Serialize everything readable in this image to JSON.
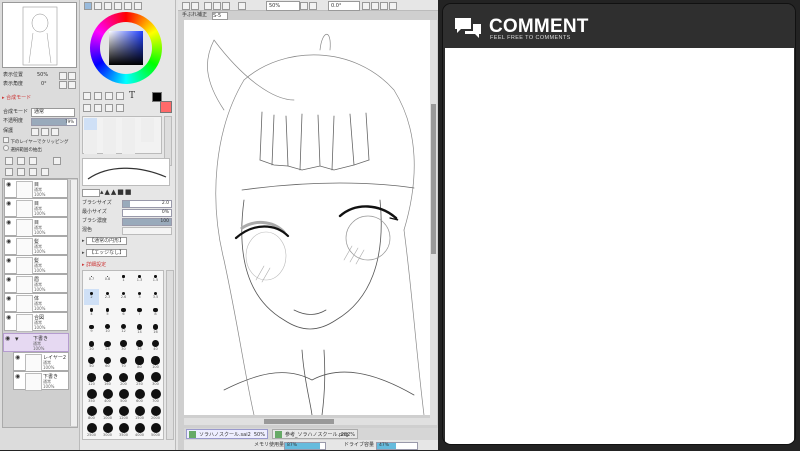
{
  "navigator": {
    "zoom_label": "表示位置",
    "zoom_value": "50%",
    "angle_label": "表示角度",
    "angle_value": "0°"
  },
  "layer_props": {
    "mode_label": "合成モード",
    "mode_value": "通常",
    "opacity_label": "不透明度",
    "opacity_value": "79%",
    "protect_label": "保護",
    "clip_label": "下のレイヤーでクリッピング",
    "select_label": "選択範囲の抽出"
  },
  "layers": [
    {
      "name": "目",
      "mode": "通常",
      "opacity": "100%"
    },
    {
      "name": "目",
      "mode": "通常",
      "opacity": "100%"
    },
    {
      "name": "目",
      "mode": "通常",
      "opacity": "100%"
    },
    {
      "name": "髪",
      "mode": "通常",
      "opacity": "100%"
    },
    {
      "name": "髪",
      "mode": "通常",
      "opacity": "100%"
    },
    {
      "name": "眉",
      "mode": "通常",
      "opacity": "100%"
    },
    {
      "name": "体",
      "mode": "通常",
      "opacity": "100%"
    },
    {
      "name": "合図",
      "mode": "通常",
      "opacity": "100%"
    }
  ],
  "folder": {
    "name": "下書き",
    "mode": "通常",
    "opacity": "100%"
  },
  "sublayers": [
    {
      "name": "レイヤー2",
      "mode": "通常",
      "opacity": "100%"
    },
    {
      "name": "下書き",
      "mode": "通常",
      "opacity": "100%"
    }
  ],
  "tool": {
    "size_label": "ブラシサイズ",
    "size_value": "2.0",
    "min_label": "最小サイズ",
    "min_value": "0%",
    "density_label": "ブラシ濃度",
    "density_value": "100",
    "blend_label": "混色",
    "mode_a": "【通常の円形】",
    "mode_b": "【エッジなし】",
    "extra_label": "詳細設定"
  },
  "brush_sizes": [
    "0.7",
    "0.8",
    "1",
    "1.3",
    "1.5",
    "2",
    "2.3",
    "2.6",
    "3",
    "3.5",
    "4",
    "5",
    "6",
    "7",
    "8",
    "9",
    "10",
    "12",
    "14",
    "16",
    "20",
    "25",
    "30",
    "35",
    "40",
    "50",
    "60",
    "70",
    "80",
    "100",
    "120",
    "160",
    "200",
    "250",
    "300",
    "350",
    "400",
    "500",
    "600",
    "700",
    "800",
    "1000",
    "1200",
    "1500",
    "2000",
    "2500",
    "3000",
    "3500",
    "4000",
    "5000"
  ],
  "toolbar": {
    "zoom_value": "50%",
    "angle_value": "0.0°",
    "stabilizer_label": "手ぶれ補正",
    "stabilizer_value": "S-5"
  },
  "tabs": [
    {
      "label": "ソラハノスクール.sai2",
      "zoom": "50%"
    },
    {
      "label": "参考_ソラハノスクール.png",
      "zoom": "282%"
    }
  ],
  "status": {
    "memory_label": "メモリ使用量",
    "memory_value": "87%",
    "disk_label": "ドライブ容量",
    "disk_value": "47%"
  },
  "comment": {
    "title": "COMMENT",
    "subtitle": "FEEL FREE TO COMMENTS"
  },
  "colors": {
    "fg": "#000000",
    "bg": "#ff6a6a",
    "dark": "#2f2f2f"
  }
}
